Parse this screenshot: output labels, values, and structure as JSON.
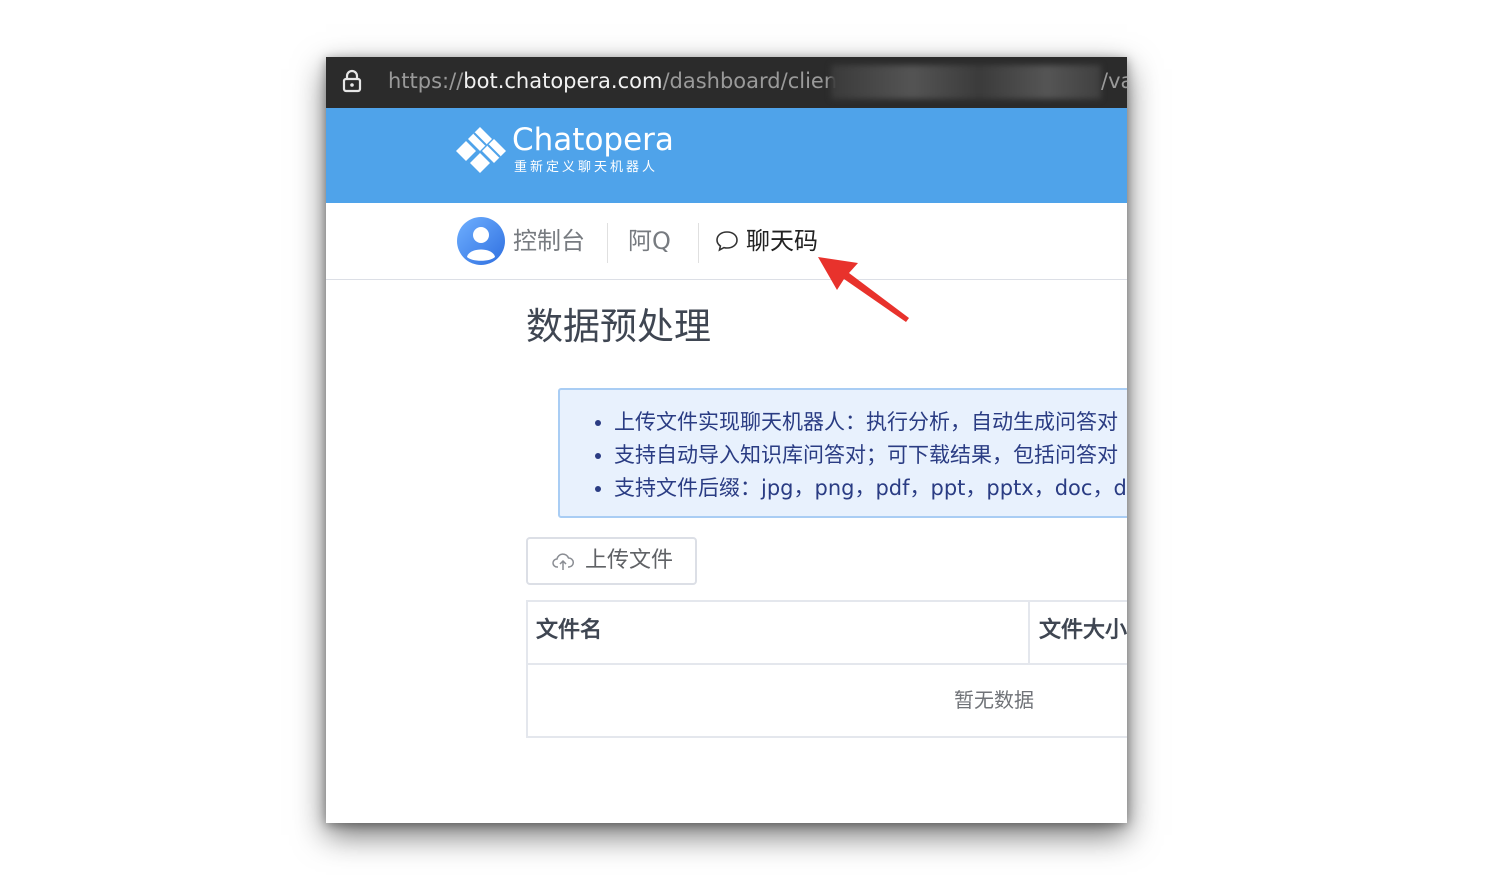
{
  "browser": {
    "url_scheme": "https://",
    "url_host": "bot.chatopera.com",
    "url_path": "/dashboard/clients/(",
    "url_tail": "/va"
  },
  "brand": {
    "name": "Chatopera",
    "tagline": "重新定义聊天机器人"
  },
  "nav": {
    "console": "控制台",
    "aq": "阿Q",
    "chatcode": "聊天码"
  },
  "page": {
    "title": "数据预处理",
    "info": [
      "上传文件实现聊天机器人：执行分析，自动生成问答对",
      "支持自动导入知识库问答对；可下载结果，包括问答对",
      "支持文件后缀：jpg，png，pdf，ppt，pptx，doc，docx"
    ],
    "upload_label": "上传文件",
    "table": {
      "columns": [
        "文件名",
        "文件大小"
      ],
      "empty_text": "暂无数据"
    }
  },
  "colors": {
    "brand_blue": "#4fa3ea",
    "annotation_arrow": "#e8322c"
  }
}
